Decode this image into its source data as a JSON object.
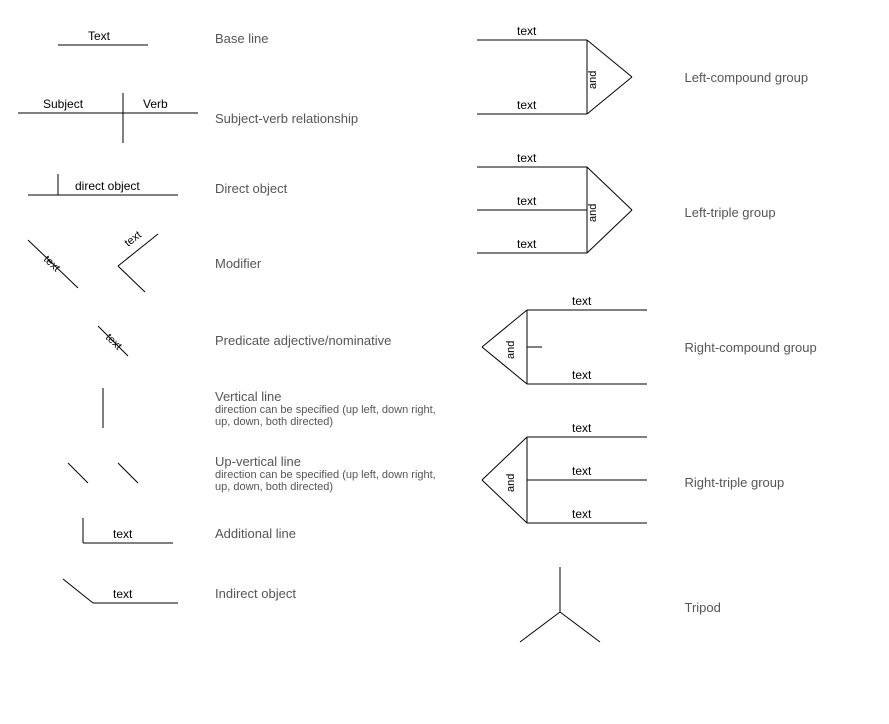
{
  "left": {
    "baseline": {
      "label": "Base line",
      "text": "Text"
    },
    "subjectVerb": {
      "label": "Subject-verb relationship",
      "subject": "Subject",
      "verb": "Verb"
    },
    "directObject": {
      "label": "Direct object",
      "text": "direct object"
    },
    "modifier": {
      "label": "Modifier",
      "text1": "text",
      "text2": "text"
    },
    "predicate": {
      "label": "Predicate adjective/nominative",
      "text": "text"
    },
    "verticalLine": {
      "label": "Vertical line",
      "sub": "direction can be specified (up left, down right, up, down, both directed)"
    },
    "upVerticalLine": {
      "label": "Up-vertical line",
      "sub": "direction can be specified (up left, down right, up, down, both directed)"
    },
    "additionalLine": {
      "label": "Additional line",
      "text": "text"
    },
    "indirectObject": {
      "label": "Indirect object",
      "text": "text"
    }
  },
  "right": {
    "leftCompound": {
      "label": "Left-compound group",
      "text1": "text",
      "text2": "text",
      "and": "and"
    },
    "leftTriple": {
      "label": "Left-triple group",
      "text1": "text",
      "text2": "text",
      "text3": "text",
      "and": "and"
    },
    "rightCompound": {
      "label": "Right-compound group",
      "text1": "text",
      "text2": "text",
      "and": "and"
    },
    "rightTriple": {
      "label": "Right-triple group",
      "text1": "text",
      "text2": "text",
      "text3": "text",
      "and": "and"
    },
    "tripod": {
      "label": "Tripod"
    }
  }
}
